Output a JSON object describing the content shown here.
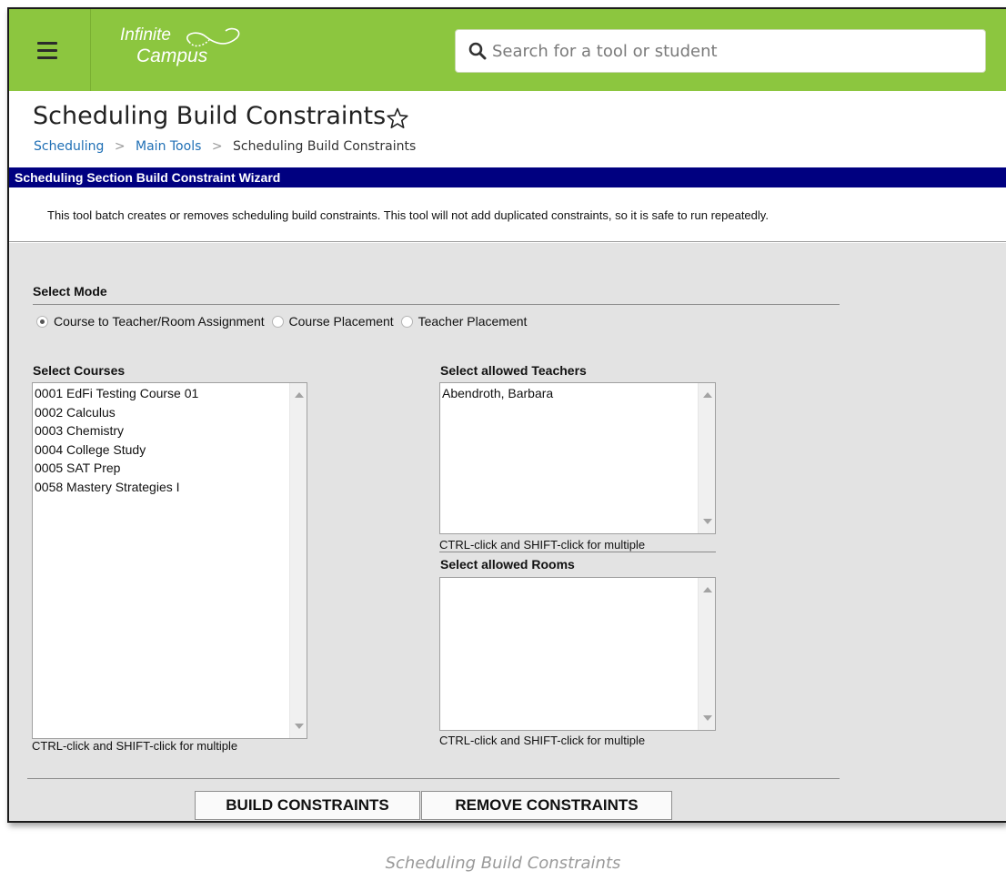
{
  "app": {
    "logo_line1": "Infinite",
    "logo_line2": "Campus",
    "search_placeholder": "Search for a tool or student"
  },
  "header": {
    "title": "Scheduling Build Constraints",
    "breadcrumb": [
      "Scheduling",
      "Main Tools",
      "Scheduling Build Constraints"
    ]
  },
  "wizard": {
    "title": "Scheduling Section Build Constraint Wizard",
    "description": "This tool batch creates or removes scheduling build constraints. This tool will not add duplicated constraints, so it is safe to run repeatedly.",
    "mode": {
      "label": "Select Mode",
      "options": [
        "Course to Teacher/Room Assignment",
        "Course Placement",
        "Teacher Placement"
      ],
      "selected": "Course to Teacher/Room Assignment"
    },
    "courses": {
      "label": "Select Courses",
      "items": [
        "0001 EdFi Testing Course 01",
        "0002 Calculus",
        "0003 Chemistry",
        "0004 College Study",
        "0005 SAT Prep",
        "0058 Mastery Strategies I"
      ],
      "hint": "CTRL-click and SHIFT-click for multiple"
    },
    "teachers": {
      "label": "Select allowed Teachers",
      "items": [
        "Abendroth, Barbara"
      ],
      "hint": "CTRL-click and SHIFT-click for multiple"
    },
    "rooms": {
      "label": "Select allowed Rooms",
      "items": [],
      "hint": "CTRL-click and SHIFT-click for multiple"
    },
    "buttons": {
      "build": "BUILD CONSTRAINTS",
      "remove": "REMOVE CONSTRAINTS"
    }
  },
  "caption": "Scheduling Build Constraints"
}
